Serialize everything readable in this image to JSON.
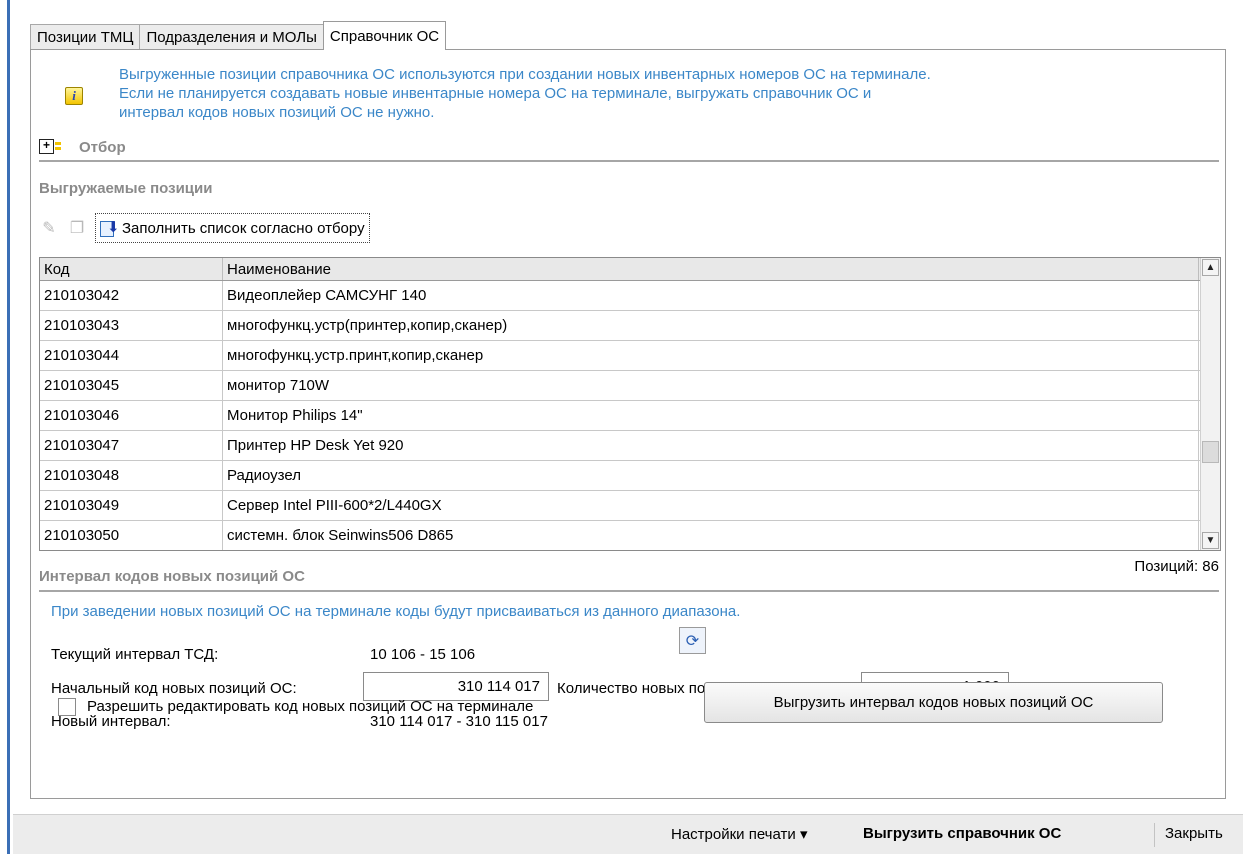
{
  "tabs": [
    {
      "label": "Позиции ТМЦ"
    },
    {
      "label": "Подразделения и МОЛы"
    },
    {
      "label": "Справочник ОС"
    }
  ],
  "info": {
    "line1": "Выгруженные позиции справочника ОС используются при создании новых инвентарных номеров ОС на терминале.",
    "line2": "Если не планируется создавать новые инвентарные номера ОС на терминале, выгружать справочник ОС и",
    "line3": "интервал кодов новых позиций ОС не нужно."
  },
  "filter": {
    "label": "Отбор"
  },
  "export_positions": {
    "header": "Выгружаемые позиции",
    "fill_button": "Заполнить список согласно отбору",
    "columns": [
      "Код",
      "Наименование"
    ],
    "rows": [
      {
        "code": "210103042",
        "name": "Видеоплейер САМСУНГ 140"
      },
      {
        "code": "210103043",
        "name": "многофункц.устр(принтер,копир,сканер)"
      },
      {
        "code": "210103044",
        "name": "многофункц.устр.принт,копир,сканер"
      },
      {
        "code": "210103045",
        "name": "монитор 710W"
      },
      {
        "code": "210103046",
        "name": "Монитор Philips 14\""
      },
      {
        "code": "210103047",
        "name": "Принтер HP Desk Yet 920"
      },
      {
        "code": "210103048",
        "name": "Радиоузел"
      },
      {
        "code": "210103049",
        "name": "Сервер Intel PIII-600*2/L440GX"
      },
      {
        "code": "210103050",
        "name": "системн. блок Seinwins506 D865"
      }
    ],
    "count_label": "Позиций: 86"
  },
  "interval": {
    "header": "Интервал кодов новых позиций ОС",
    "note": "При заведении новых позиций ОС на терминале коды будут присваиваться из данного диапазона.",
    "current_label": "Текущий интервал ТСД:",
    "current_value": "10 106 - 15 106",
    "start_label": "Начальный код новых позиций ОС:",
    "start_value": "310 114 017",
    "qty_label": "Количество новых позиций ОС:",
    "qty_value": "1 000",
    "new_label": "Новый интервал:",
    "new_value": "310 114 017 - 310 115 017",
    "allow_edit_label": "Разрешить редактировать код новых позиций ОС на терминале",
    "allow_edit_checked": false,
    "export_button": "Выгрузить интервал кодов новых позиций ОС"
  },
  "statusbar": {
    "print_settings": "Настройки печати",
    "export_catalog": "Выгрузить справочник ОС",
    "close": "Закрыть"
  }
}
